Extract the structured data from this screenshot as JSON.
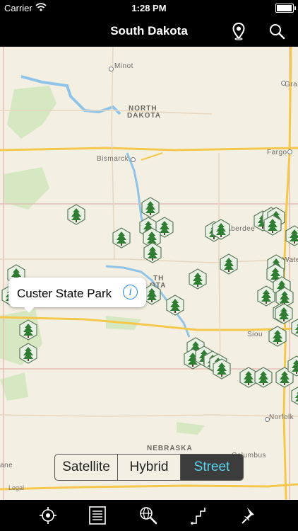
{
  "status": {
    "carrier": "Carrier",
    "time": "1:28 PM",
    "battery_level": 0.95
  },
  "nav": {
    "title": "South Dakota",
    "pin_icon": "map-pin-icon",
    "search_icon": "search-icon"
  },
  "map": {
    "labels": {
      "north_dakota_1": "NORTH",
      "north_dakota_2": "DAKOTA",
      "minot": "Minot",
      "bismarck": "Bismarck",
      "fargo": "Fargo",
      "gra": "Gra",
      "aberdeen": "Aberdee",
      "sd_1": "TH",
      "sd_2": "OTA",
      "wate": "Wate",
      "siou": "Siou",
      "norfolk": "Norfolk",
      "nebraska": "NEBRASKA",
      "columbus": "Columbus",
      "ane": "ane"
    },
    "marker_icon": "pine-tree-icon",
    "callout": {
      "label": "Custer State Park",
      "info_icon": "info-icon"
    },
    "legal": "Legal"
  },
  "segments": [
    "Satellite",
    "Hybrid",
    "Street"
  ],
  "segments_selected": "Street",
  "tabs": [
    {
      "name": "locate-icon"
    },
    {
      "name": "list-icon"
    },
    {
      "name": "web-search-icon"
    },
    {
      "name": "route-icon"
    },
    {
      "name": "pushpin-icon"
    }
  ],
  "colors": {
    "accent": "#5ad4f0",
    "info": "#1a82f7",
    "marker": "#2e7d32",
    "water": "#8fc3e8",
    "park": "#c9e1b0",
    "road": "#f5c84c"
  }
}
